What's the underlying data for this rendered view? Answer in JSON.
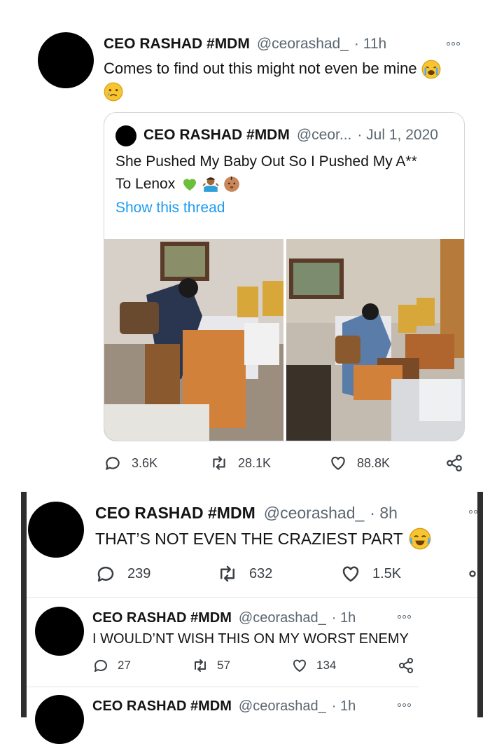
{
  "tweet1": {
    "name": "CEO RASHAD #MDM",
    "handle": "@ceorashad_",
    "time": "· 11h",
    "text": "Comes to find out this might not even be mine",
    "emojis": [
      "loudly-crying-face",
      "crying-face"
    ],
    "quote": {
      "name": "CEO RASHAD #MDM",
      "handle": "@ceor...",
      "date": "· Jul 1, 2020",
      "text_line1": "She Pushed My Baby Out So I Pushed My A**",
      "text_line2": "To Lenox",
      "emojis": [
        "green-heart",
        "man-shrugging",
        "baby"
      ],
      "show_thread": "Show this thread",
      "link_color": "#1d9bf0"
    },
    "stats": {
      "replies": "3.6K",
      "retweets": "28.1K",
      "likes": "88.8K"
    }
  },
  "tweet2": {
    "name": "CEO RASHAD #MDM",
    "handle": "@ceorashad_",
    "time": "· 8h",
    "text": "THAT’S NOT EVEN THE CRAZIEST PART",
    "emojis": [
      "face-with-tears-of-joy"
    ],
    "stats": {
      "replies": "239",
      "retweets": "632",
      "likes": "1.5K"
    }
  },
  "tweet3": {
    "name": "CEO RASHAD #MDM",
    "handle": "@ceorashad_",
    "time": "· 1h",
    "text": "I WOULD’NT WISH THIS ON MY WORST ENEMY",
    "stats": {
      "replies": "27",
      "retweets": "57",
      "likes": "134"
    }
  },
  "tweet4": {
    "name": "CEO RASHAD #MDM",
    "handle": "@ceorashad_",
    "time": "· 1h"
  },
  "icons": [
    "reply-icon",
    "retweet-icon",
    "like-icon",
    "share-icon",
    "more-icon"
  ]
}
